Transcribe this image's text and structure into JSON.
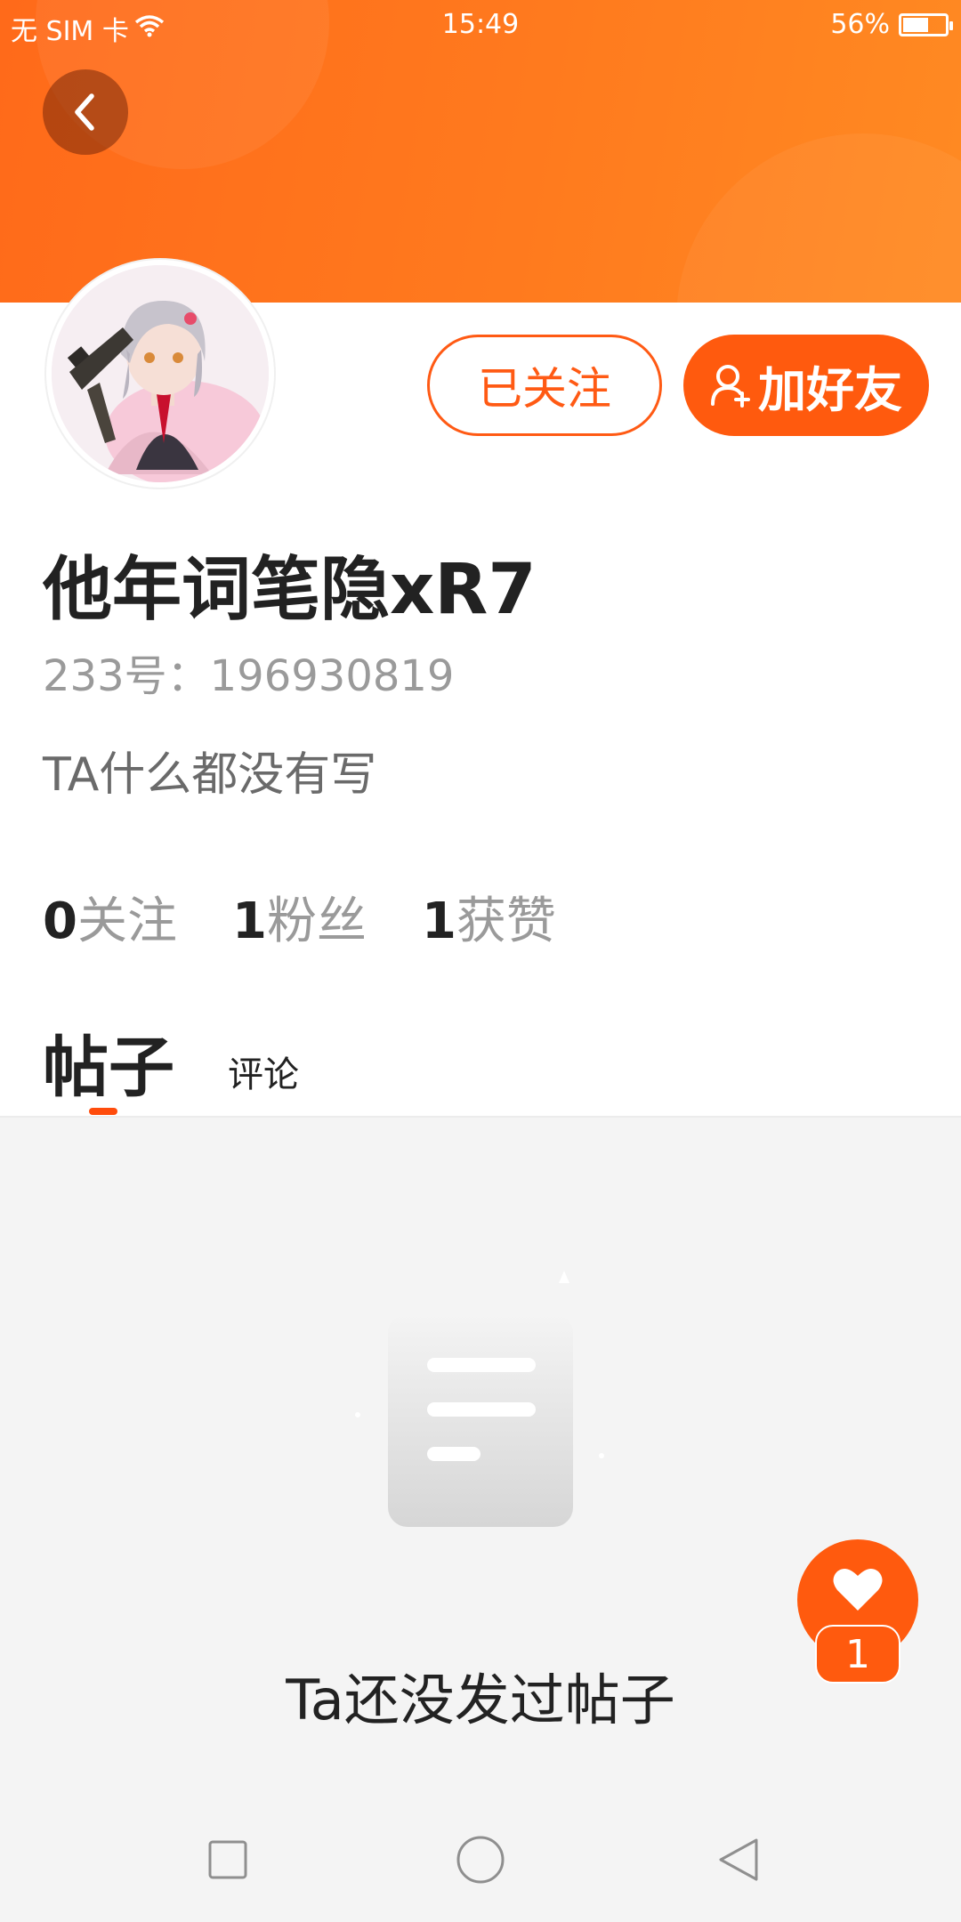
{
  "status_bar": {
    "carrier": "无 SIM 卡",
    "time": "15:49",
    "battery_percent": "56%",
    "battery_level": 0.56
  },
  "header": {
    "back_icon": "chevron-left-icon",
    "color_from": "#ff6a1a",
    "color_to": "#ff8a22"
  },
  "profile": {
    "avatar_icon": "anime-girl-avatar",
    "followed_label": "已关注",
    "add_friend_label": "加好友",
    "add_friend_icon": "user-plus-icon",
    "username": "他年词笔隐xR7",
    "user_id": "233号：196930819",
    "bio": "TA什么都没有写"
  },
  "stats": [
    {
      "num": "0",
      "label": "关注"
    },
    {
      "num": "1",
      "label": "粉丝"
    },
    {
      "num": "1",
      "label": "获赞"
    }
  ],
  "tabs": {
    "posts": "帖子",
    "comments": "评论"
  },
  "empty_state": {
    "icon": "document-icon",
    "text": "Ta还没发过帖子"
  },
  "like_fab": {
    "icon": "heart-icon",
    "count": "1"
  },
  "accent_color": "#ff5a0e",
  "nav": {
    "recent_icon": "square-icon",
    "home_icon": "circle-icon",
    "back_icon": "triangle-back-icon"
  }
}
